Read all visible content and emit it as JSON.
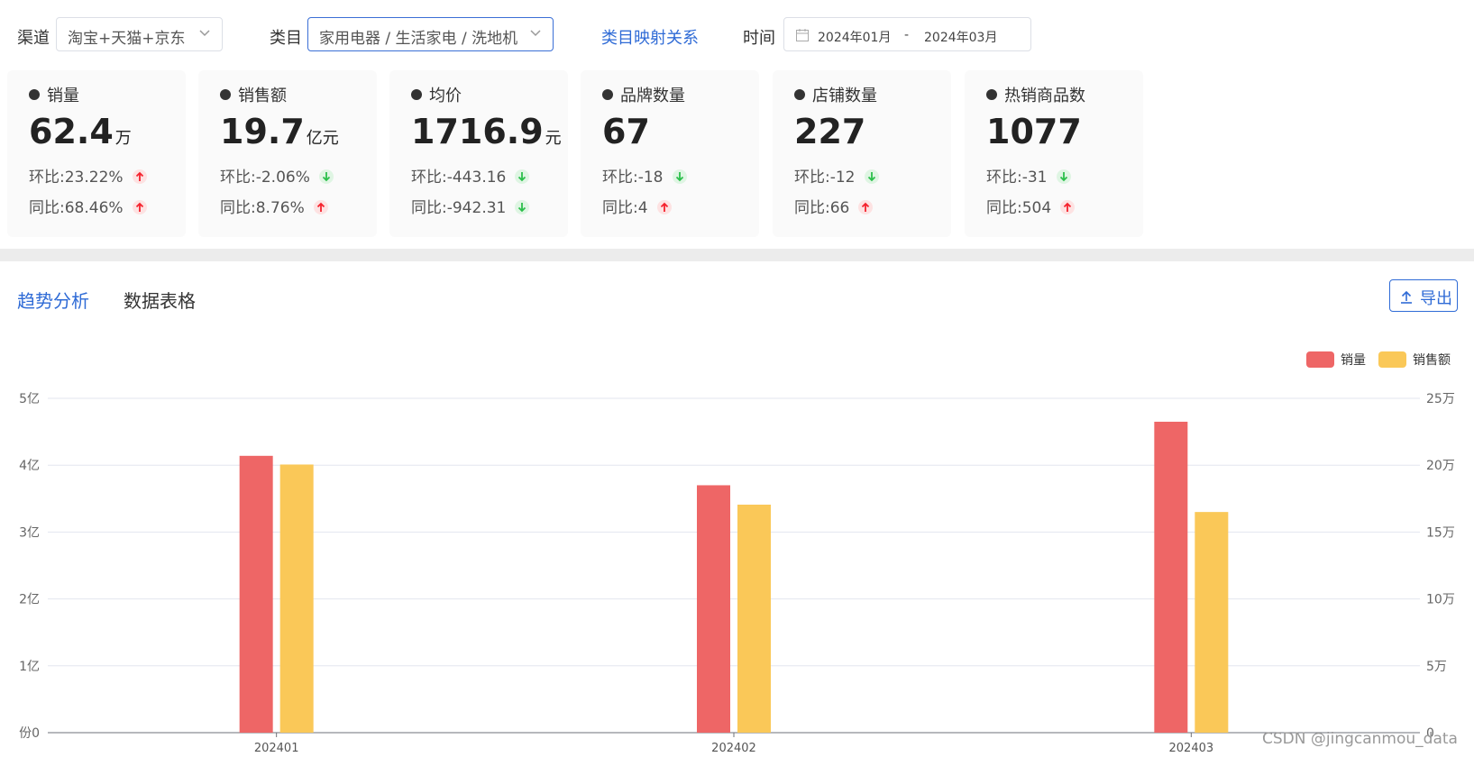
{
  "filters": {
    "channel_label": "渠道",
    "channel_value": "淘宝+天猫+京东",
    "category_label": "类目",
    "category_value": "家用电器 / 生活家电 / 洗地机",
    "mapping_link": "类目映射关系",
    "time_label": "时间",
    "date_start": "2024年01月",
    "date_sep": "-",
    "date_end": "2024年03月"
  },
  "cards": [
    {
      "title": "销量",
      "value": "62.4",
      "unit": "万",
      "mom_label": "环比:",
      "mom": "23.22%",
      "mom_dir": "up",
      "yoy_label": "同比:",
      "yoy": "68.46%",
      "yoy_dir": "up"
    },
    {
      "title": "销售额",
      "value": "19.7",
      "unit": "亿元",
      "mom_label": "环比:",
      "mom": "-2.06%",
      "mom_dir": "down",
      "yoy_label": "同比:",
      "yoy": "8.76%",
      "yoy_dir": "up"
    },
    {
      "title": "均价",
      "value": "1716.9",
      "unit": "元",
      "mom_label": "环比:",
      "mom": "-443.16",
      "mom_dir": "down",
      "yoy_label": "同比:",
      "yoy": "-942.31",
      "yoy_dir": "down"
    },
    {
      "title": "品牌数量",
      "value": "67",
      "unit": "",
      "mom_label": "环比:",
      "mom": "-18",
      "mom_dir": "down",
      "yoy_label": "同比:",
      "yoy": "4",
      "yoy_dir": "up"
    },
    {
      "title": "店铺数量",
      "value": "227",
      "unit": "",
      "mom_label": "环比:",
      "mom": "-12",
      "mom_dir": "down",
      "yoy_label": "同比:",
      "yoy": "66",
      "yoy_dir": "up"
    },
    {
      "title": "热销商品数",
      "value": "1077",
      "unit": "",
      "mom_label": "环比:",
      "mom": "-31",
      "mom_dir": "down",
      "yoy_label": "同比:",
      "yoy": "504",
      "yoy_dir": "up"
    }
  ],
  "tabs": [
    "趋势分析",
    "数据表格"
  ],
  "export_label": "导出",
  "watermark": "CSDN @jingcanmou_data",
  "colors": {
    "up": "#f5222d",
    "down": "#2bbf4a",
    "accent": "#2f6bd6",
    "sales_volume": "#ee6666",
    "sales_amount": "#fac858"
  },
  "chart_data": {
    "type": "bar",
    "categories": [
      "202401",
      "202402",
      "202403"
    ],
    "series": [
      {
        "name": "销量",
        "axis": "left",
        "values": [
          414000000,
          370000000,
          465000000
        ]
      },
      {
        "name": "销售额",
        "axis": "right",
        "values": [
          200500,
          170500,
          165000
        ]
      }
    ],
    "y_left": {
      "ylim": [
        0,
        500000000
      ],
      "ticks": [
        0,
        100000000,
        200000000,
        300000000,
        400000000,
        500000000
      ],
      "tick_labels": [
        "份0",
        "1亿",
        "2亿",
        "3亿",
        "4亿",
        "5亿"
      ]
    },
    "y_right": {
      "ylim": [
        0,
        250000
      ],
      "ticks": [
        0,
        50000,
        100000,
        150000,
        200000,
        250000
      ],
      "tick_labels": [
        "0",
        "5万",
        "10万",
        "15万",
        "20万",
        "25万"
      ]
    },
    "legend_position": "top-right",
    "grid": true
  }
}
